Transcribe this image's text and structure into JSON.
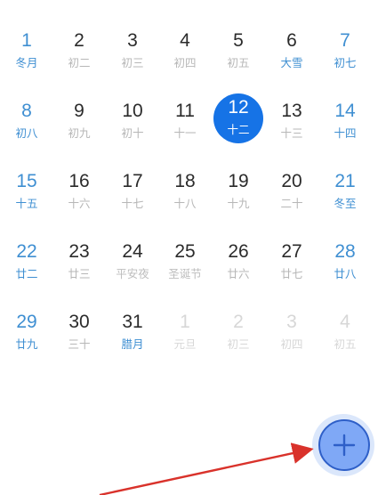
{
  "calendar": {
    "weeks": [
      [
        {
          "day": "1",
          "lunar": "冬月",
          "type": "weekend"
        },
        {
          "day": "2",
          "lunar": "初二",
          "type": "normal"
        },
        {
          "day": "3",
          "lunar": "初三",
          "type": "normal"
        },
        {
          "day": "4",
          "lunar": "初四",
          "type": "normal"
        },
        {
          "day": "5",
          "lunar": "初五",
          "type": "normal"
        },
        {
          "day": "6",
          "lunar": "大雪",
          "type": "festival"
        },
        {
          "day": "7",
          "lunar": "初七",
          "type": "weekend"
        }
      ],
      [
        {
          "day": "8",
          "lunar": "初八",
          "type": "weekend"
        },
        {
          "day": "9",
          "lunar": "初九",
          "type": "normal"
        },
        {
          "day": "10",
          "lunar": "初十",
          "type": "normal"
        },
        {
          "day": "11",
          "lunar": "十一",
          "type": "normal"
        },
        {
          "day": "12",
          "lunar": "十二",
          "type": "today"
        },
        {
          "day": "13",
          "lunar": "十三",
          "type": "normal"
        },
        {
          "day": "14",
          "lunar": "十四",
          "type": "weekend"
        }
      ],
      [
        {
          "day": "15",
          "lunar": "十五",
          "type": "weekend"
        },
        {
          "day": "16",
          "lunar": "十六",
          "type": "normal"
        },
        {
          "day": "17",
          "lunar": "十七",
          "type": "normal"
        },
        {
          "day": "18",
          "lunar": "十八",
          "type": "normal"
        },
        {
          "day": "19",
          "lunar": "十九",
          "type": "normal"
        },
        {
          "day": "20",
          "lunar": "二十",
          "type": "normal"
        },
        {
          "day": "21",
          "lunar": "冬至",
          "type": "weekend"
        }
      ],
      [
        {
          "day": "22",
          "lunar": "廿二",
          "type": "weekend"
        },
        {
          "day": "23",
          "lunar": "廿三",
          "type": "normal"
        },
        {
          "day": "24",
          "lunar": "平安夜",
          "type": "holiday"
        },
        {
          "day": "25",
          "lunar": "圣诞节",
          "type": "holiday"
        },
        {
          "day": "26",
          "lunar": "廿六",
          "type": "normal"
        },
        {
          "day": "27",
          "lunar": "廿七",
          "type": "normal"
        },
        {
          "day": "28",
          "lunar": "廿八",
          "type": "weekend"
        }
      ],
      [
        {
          "day": "29",
          "lunar": "廿九",
          "type": "weekend"
        },
        {
          "day": "30",
          "lunar": "三十",
          "type": "normal"
        },
        {
          "day": "31",
          "lunar": "腊月",
          "type": "month-start"
        },
        {
          "day": "1",
          "lunar": "元旦",
          "type": "other-month"
        },
        {
          "day": "2",
          "lunar": "初三",
          "type": "other-month"
        },
        {
          "day": "3",
          "lunar": "初四",
          "type": "other-month"
        },
        {
          "day": "4",
          "lunar": "初五",
          "type": "other-month"
        }
      ]
    ]
  },
  "fab": {
    "icon": "plus-icon",
    "fill_color": "#7fa8f6",
    "border_color": "#2e5fc8"
  },
  "colors": {
    "accent": "#1673e6",
    "weekend": "#3f8fd2",
    "annotation_arrow": "#d9322b"
  },
  "annotation": {
    "icon": "red-arrow-icon"
  }
}
